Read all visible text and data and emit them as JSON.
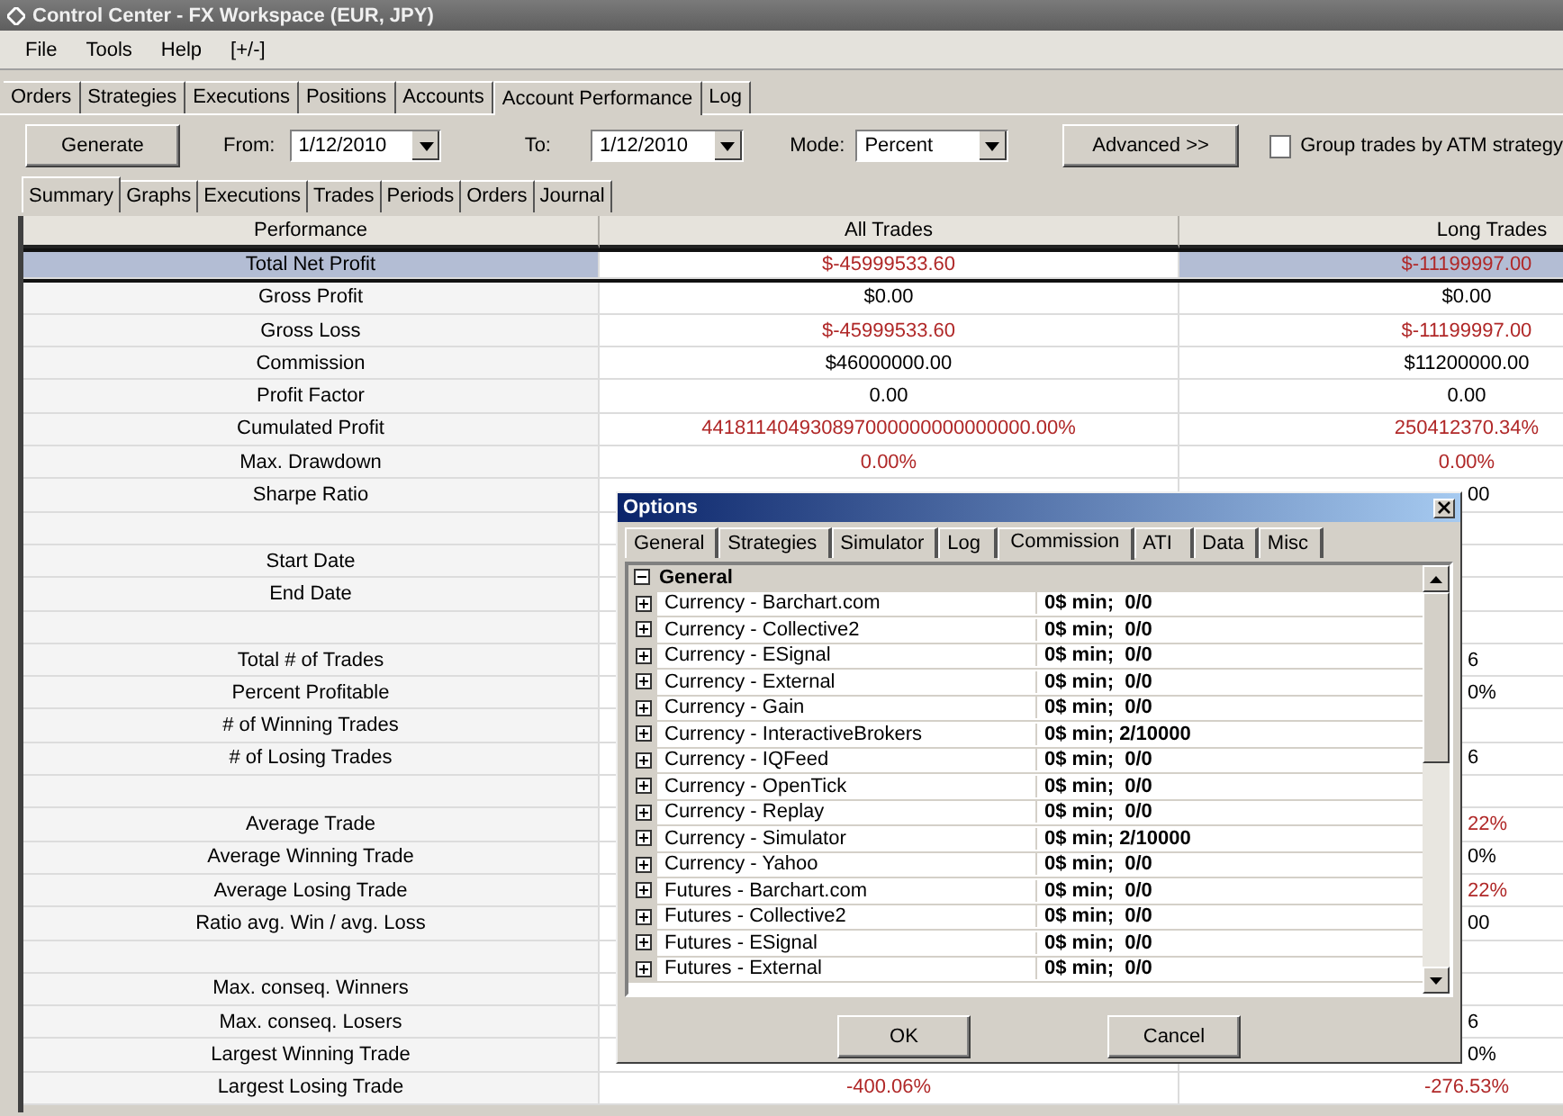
{
  "window": {
    "title": "Control Center - FX Workspace (EUR, JPY)"
  },
  "menu": [
    "File",
    "Tools",
    "Help",
    "[+/-]"
  ],
  "tabs": [
    {
      "label": "Orders",
      "selected": false
    },
    {
      "label": "Strategies",
      "selected": false
    },
    {
      "label": "Executions",
      "selected": false
    },
    {
      "label": "Positions",
      "selected": false
    },
    {
      "label": "Accounts",
      "selected": false
    },
    {
      "label": "Account Performance",
      "selected": true
    },
    {
      "label": "Log",
      "selected": false
    }
  ],
  "toolbar": {
    "generate_button": "Generate",
    "from_label": "From:",
    "from_value": "1/12/2010",
    "to_label": "To:",
    "to_value": "1/12/2010",
    "mode_label": "Mode:",
    "mode_value": "Percent",
    "advanced_button": "Advanced >>",
    "group_checkbox": {
      "label": "Group trades by ATM strategy",
      "checked": false
    }
  },
  "subtabs": [
    {
      "label": "Summary",
      "selected": true
    },
    {
      "label": "Graphs",
      "selected": false
    },
    {
      "label": "Executions",
      "selected": false
    },
    {
      "label": "Trades",
      "selected": false
    },
    {
      "label": "Periods",
      "selected": false
    },
    {
      "label": "Orders",
      "selected": false
    },
    {
      "label": "Journal",
      "selected": false
    }
  ],
  "table": {
    "columns": [
      "Performance",
      "All Trades",
      "Long Trades"
    ],
    "rows": [
      {
        "kind": "metric",
        "label": "Total Net Profit",
        "all": {
          "text": "$-45999533.60",
          "negative": true
        },
        "long": {
          "text": "$-11199997.00",
          "negative": true
        },
        "selected": true,
        "covered": false
      },
      {
        "kind": "metric",
        "label": "Gross Profit",
        "all": {
          "text": "$0.00",
          "negative": false
        },
        "long": {
          "text": "$0.00",
          "negative": false
        },
        "selected": false,
        "covered": false
      },
      {
        "kind": "metric",
        "label": "Gross Loss",
        "all": {
          "text": "$-45999533.60",
          "negative": true
        },
        "long": {
          "text": "$-11199997.00",
          "negative": true
        },
        "selected": false,
        "covered": false
      },
      {
        "kind": "metric",
        "label": "Commission",
        "all": {
          "text": "$46000000.00",
          "negative": false
        },
        "long": {
          "text": "$11200000.00",
          "negative": false
        },
        "selected": false,
        "covered": false
      },
      {
        "kind": "metric",
        "label": "Profit Factor",
        "all": {
          "text": "0.00",
          "negative": false
        },
        "long": {
          "text": "0.00",
          "negative": false
        },
        "selected": false,
        "covered": false
      },
      {
        "kind": "metric",
        "label": "Cumulated Profit",
        "all": {
          "text": "441811404930897000000000000000.00%",
          "negative": true
        },
        "long": {
          "text": "250412370.34%",
          "negative": true
        },
        "selected": false,
        "covered": false
      },
      {
        "kind": "metric",
        "label": "Max. Drawdown",
        "all": {
          "text": "0.00%",
          "negative": true
        },
        "long": {
          "text": "0.00%",
          "negative": true
        },
        "selected": false,
        "covered": false
      },
      {
        "kind": "metric",
        "label": "Sharpe Ratio",
        "long": {
          "text": "00",
          "negative": false
        },
        "selected": false,
        "covered": true
      },
      {
        "kind": "spacer",
        "selected": false
      },
      {
        "kind": "metric",
        "label": "Start Date",
        "selected": false
      },
      {
        "kind": "metric",
        "label": "End Date",
        "selected": false
      },
      {
        "kind": "spacer",
        "selected": false
      },
      {
        "kind": "metric",
        "label": "Total # of Trades",
        "long": {
          "text": "6",
          "negative": false
        },
        "selected": false,
        "covered": true
      },
      {
        "kind": "metric",
        "label": "Percent Profitable",
        "long": {
          "text": "0%",
          "negative": false
        },
        "selected": false,
        "covered": true
      },
      {
        "kind": "metric",
        "label": "# of Winning Trades",
        "selected": false
      },
      {
        "kind": "metric",
        "label": "# of Losing Trades",
        "long": {
          "text": "6",
          "negative": false
        },
        "selected": false,
        "covered": true
      },
      {
        "kind": "spacer",
        "selected": false
      },
      {
        "kind": "metric",
        "label": "Average Trade",
        "long": {
          "text": "22%",
          "negative": true
        },
        "selected": false,
        "covered": true
      },
      {
        "kind": "metric",
        "label": "Average Winning Trade",
        "long": {
          "text": "0%",
          "negative": false
        },
        "selected": false,
        "covered": true
      },
      {
        "kind": "metric",
        "label": "Average Losing Trade",
        "long": {
          "text": "22%",
          "negative": true
        },
        "selected": false,
        "covered": true
      },
      {
        "kind": "metric",
        "label": "Ratio avg. Win / avg. Loss",
        "long": {
          "text": "00",
          "negative": false
        },
        "selected": false,
        "covered": true
      },
      {
        "kind": "spacer",
        "selected": false
      },
      {
        "kind": "metric",
        "label": "Max. conseq. Winners",
        "selected": false
      },
      {
        "kind": "metric",
        "label": "Max. conseq. Losers",
        "long": {
          "text": "6",
          "negative": false
        },
        "selected": false,
        "covered": true
      },
      {
        "kind": "metric",
        "label": "Largest Winning Trade",
        "long": {
          "text": "0%",
          "negative": false
        },
        "selected": false,
        "covered": true
      },
      {
        "kind": "metric",
        "label": "Largest Losing Trade",
        "all": {
          "text": "-400.06%",
          "negative": true
        },
        "long": {
          "text": "-276.53%",
          "negative": true
        },
        "selected": false,
        "covered": false
      }
    ]
  },
  "dialog": {
    "title": "Options",
    "tabs": [
      {
        "label": "General",
        "selected": false
      },
      {
        "label": "Strategies",
        "selected": false
      },
      {
        "label": "Simulator",
        "selected": false
      },
      {
        "label": "Log",
        "selected": false
      },
      {
        "label": "Commission",
        "selected": true
      },
      {
        "label": "ATI",
        "selected": false
      },
      {
        "label": "Data",
        "selected": false
      },
      {
        "label": "Misc",
        "selected": false
      }
    ],
    "tree": {
      "header": "General",
      "expanded": true,
      "items": [
        {
          "name": "Currency - Barchart.com",
          "value": "0$ min;  0/0",
          "expanded": false
        },
        {
          "name": "Currency - Collective2",
          "value": "0$ min;  0/0",
          "expanded": false
        },
        {
          "name": "Currency - ESignal",
          "value": "0$ min;  0/0",
          "expanded": false
        },
        {
          "name": "Currency - External",
          "value": "0$ min;  0/0",
          "expanded": false
        },
        {
          "name": "Currency - Gain",
          "value": "0$ min;  0/0",
          "expanded": false
        },
        {
          "name": "Currency - InteractiveBrokers",
          "value": "0$ min; 2/10000",
          "expanded": false
        },
        {
          "name": "Currency - IQFeed",
          "value": "0$ min;  0/0",
          "expanded": false
        },
        {
          "name": "Currency - OpenTick",
          "value": "0$ min;  0/0",
          "expanded": false
        },
        {
          "name": "Currency - Replay",
          "value": "0$ min;  0/0",
          "expanded": false
        },
        {
          "name": "Currency - Simulator",
          "value": "0$ min; 2/10000",
          "expanded": false
        },
        {
          "name": "Currency - Yahoo",
          "value": "0$ min;  0/0",
          "expanded": false
        },
        {
          "name": "Futures - Barchart.com",
          "value": "0$ min;  0/0",
          "expanded": false
        },
        {
          "name": "Futures - Collective2",
          "value": "0$ min;  0/0",
          "expanded": false
        },
        {
          "name": "Futures - ESignal",
          "value": "0$ min;  0/0",
          "expanded": false
        },
        {
          "name": "Futures - External",
          "value": "0$ min;  0/0",
          "expanded": false
        }
      ]
    },
    "buttons": [
      "OK",
      "Cancel"
    ]
  }
}
